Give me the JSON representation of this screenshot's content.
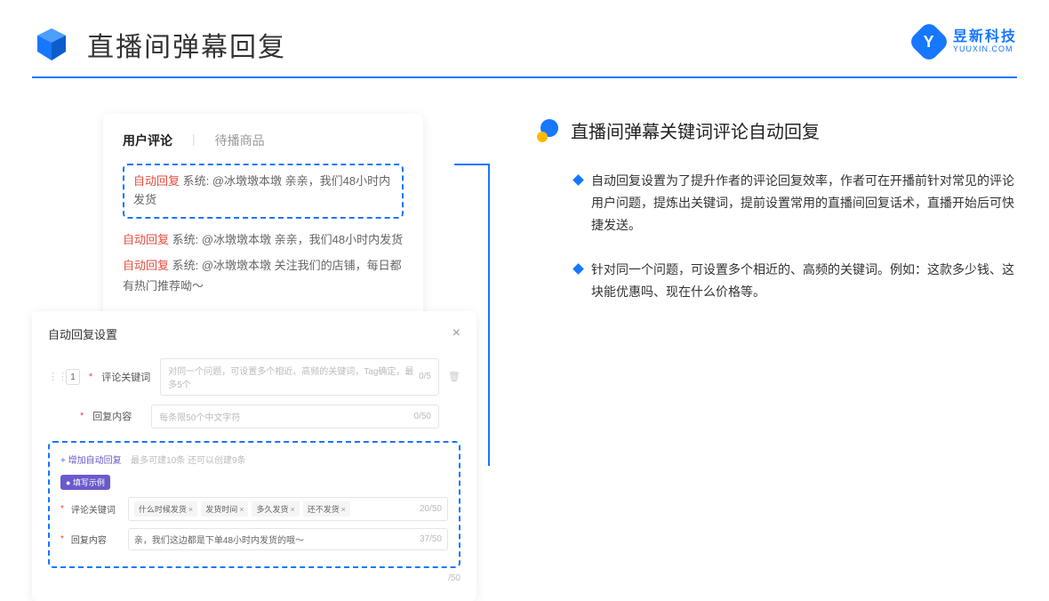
{
  "header": {
    "title": "直播间弹幕回复"
  },
  "brand": {
    "cn": "昱新科技",
    "en": "YUUXIN.COM",
    "letter": "Y"
  },
  "comments": {
    "tab1": "用户评论",
    "tab2": "待播商品",
    "tag": "自动回复",
    "highlighted": "系统: @冰墩墩本墩 亲亲，我们48小时内发货",
    "line2": "系统: @冰墩墩本墩 亲亲，我们48小时内发货",
    "line3": "系统: @冰墩墩本墩 关注我们的店铺，每日都有热门推荐呦～"
  },
  "modal": {
    "title": "自动回复设置",
    "idx": "1",
    "kw_label": "评论关键词",
    "kw_placeholder": "对同一个问题，可设置多个相近、高频的关键词，Tag确定，最多5个",
    "kw_count": "0/5",
    "content_label": "回复内容",
    "content_placeholder": "每条限50个中文字符",
    "content_count": "0/50",
    "add_text": "+ 增加自动回复",
    "add_hint": "最多可建10条 还可以创建9条",
    "example_badge": "● 填写示例",
    "ex_kw_label": "评论关键词",
    "ex_tags": [
      "什么时候发货",
      "发货时间",
      "多久发货",
      "还不发货"
    ],
    "ex_kw_count": "20/50",
    "ex_content_label": "回复内容",
    "ex_content": "亲，我们这边都是下单48小时内发货的哦～",
    "ex_content_count": "37/50",
    "outer_count": "/50"
  },
  "section": {
    "title": "直播间弹幕关键词评论自动回复",
    "b1": "自动回复设置为了提升作者的评论回复效率，作者可在开播前针对常见的评论用户问题，提炼出关键词，提前设置常用的直播间回复话术，直播开始后可快捷发送。",
    "b2": "针对同一个问题，可设置多个相近的、高频的关键词。例如：这款多少钱、这块能优惠吗、现在什么价格等。"
  }
}
